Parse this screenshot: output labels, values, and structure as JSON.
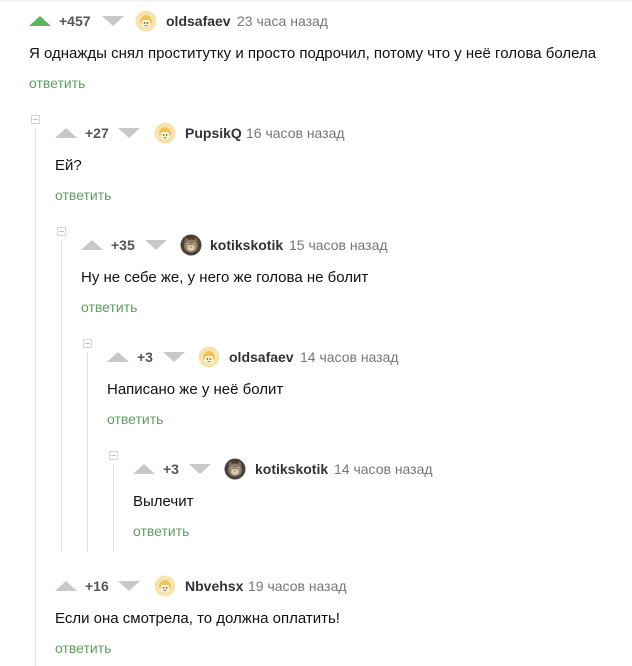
{
  "colors": {
    "vote_active": "#5cb65c",
    "vote_inactive": "#c8c8c8",
    "reply_link": "#5e9e5e"
  },
  "icons": {
    "upvote": "triangle-up-icon",
    "downvote": "triangle-down-icon",
    "avatar_default": "default-avatar-icon",
    "avatar_cat": "cat-avatar-icon",
    "collapse": "collapse-thread-icon"
  },
  "comments": [
    {
      "rating": "+457",
      "username": "oldsafaev",
      "time": "23 часа назад",
      "text": "Я однажды снял проститутку и просто подрочил, потому что у неё голова болела",
      "reply": "ответить",
      "avatar": "default"
    },
    {
      "rating": "+27",
      "username": "PupsikQ",
      "time": "16 часов назад",
      "text": "Ей?",
      "reply": "ответить",
      "avatar": "default"
    },
    {
      "rating": "+35",
      "username": "kotikskotik",
      "time": "15 часов назад",
      "text": "Ну не себе же, у него же голова не болит",
      "reply": "ответить",
      "avatar": "cat"
    },
    {
      "rating": "+3",
      "username": "oldsafaev",
      "time": "14 часов назад",
      "text": "Написано же у неё болит",
      "reply": "ответить",
      "avatar": "default"
    },
    {
      "rating": "+3",
      "username": "kotikskotik",
      "time": "14 часов назад",
      "text": "Вылечит",
      "reply": "ответить",
      "avatar": "cat"
    },
    {
      "rating": "+16",
      "username": "Nbvehsx",
      "time": "19 часов назад",
      "text": "Если она смотрела, то должна оплатить!",
      "reply": "ответить",
      "avatar": "default"
    }
  ]
}
